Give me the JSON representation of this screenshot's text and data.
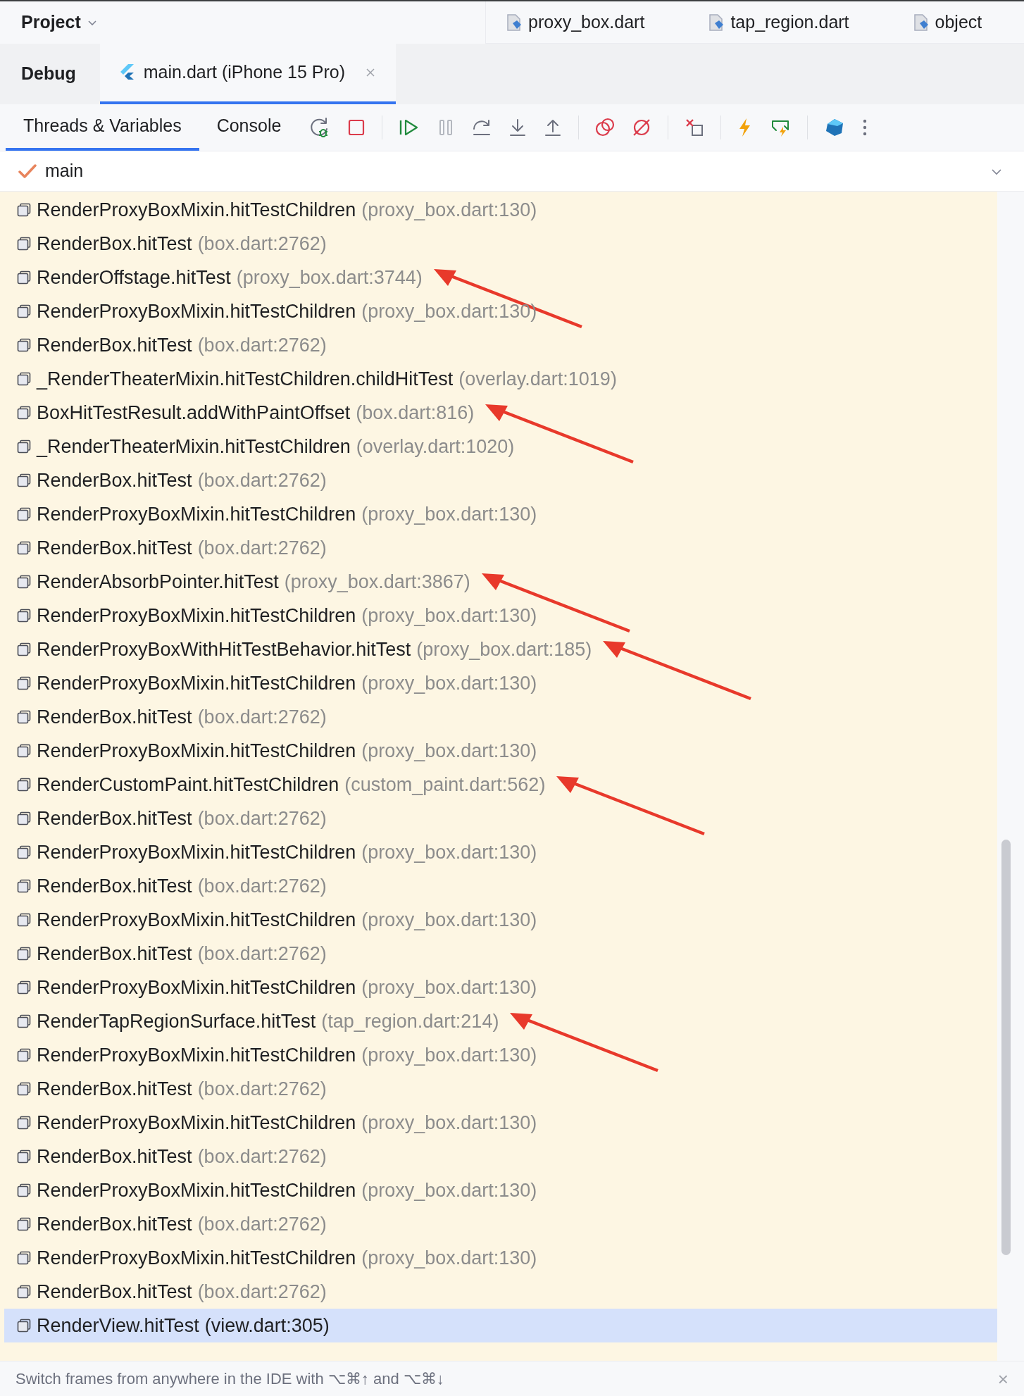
{
  "top_bar": {
    "panel_title": "Project",
    "editor_tabs": [
      {
        "label": "proxy_box.dart"
      },
      {
        "label": "tap_region.dart"
      },
      {
        "label": "object"
      }
    ]
  },
  "debug_bar": {
    "title": "Debug",
    "session_tab": {
      "label": "main.dart (iPhone 15 Pro)",
      "selected": true
    }
  },
  "toolbar": {
    "tabs": [
      {
        "label": "Threads & Variables",
        "selected": true
      },
      {
        "label": "Console",
        "selected": false
      }
    ]
  },
  "thread": {
    "name": "main"
  },
  "frames": [
    {
      "method": "RenderProxyBoxMixin.hitTestChildren",
      "location": "(proxy_box.dart:130)",
      "selected": false,
      "marked": false
    },
    {
      "method": "RenderBox.hitTest",
      "location": "(box.dart:2762)",
      "selected": false,
      "marked": false
    },
    {
      "method": "RenderOffstage.hitTest",
      "location": "(proxy_box.dart:3744)",
      "selected": false,
      "marked": true
    },
    {
      "method": "RenderProxyBoxMixin.hitTestChildren",
      "location": "(proxy_box.dart:130)",
      "selected": false,
      "marked": false
    },
    {
      "method": "RenderBox.hitTest",
      "location": "(box.dart:2762)",
      "selected": false,
      "marked": false
    },
    {
      "method": "_RenderTheaterMixin.hitTestChildren.childHitTest",
      "location": "(overlay.dart:1019)",
      "selected": false,
      "marked": false
    },
    {
      "method": "BoxHitTestResult.addWithPaintOffset",
      "location": "(box.dart:816)",
      "selected": false,
      "marked": true
    },
    {
      "method": "_RenderTheaterMixin.hitTestChildren",
      "location": "(overlay.dart:1020)",
      "selected": false,
      "marked": false
    },
    {
      "method": "RenderBox.hitTest",
      "location": "(box.dart:2762)",
      "selected": false,
      "marked": false
    },
    {
      "method": "RenderProxyBoxMixin.hitTestChildren",
      "location": "(proxy_box.dart:130)",
      "selected": false,
      "marked": false
    },
    {
      "method": "RenderBox.hitTest",
      "location": "(box.dart:2762)",
      "selected": false,
      "marked": false
    },
    {
      "method": "RenderAbsorbPointer.hitTest",
      "location": "(proxy_box.dart:3867)",
      "selected": false,
      "marked": true
    },
    {
      "method": "RenderProxyBoxMixin.hitTestChildren",
      "location": "(proxy_box.dart:130)",
      "selected": false,
      "marked": false
    },
    {
      "method": "RenderProxyBoxWithHitTestBehavior.hitTest",
      "location": "(proxy_box.dart:185)",
      "selected": false,
      "marked": true
    },
    {
      "method": "RenderProxyBoxMixin.hitTestChildren",
      "location": "(proxy_box.dart:130)",
      "selected": false,
      "marked": false
    },
    {
      "method": "RenderBox.hitTest",
      "location": "(box.dart:2762)",
      "selected": false,
      "marked": false
    },
    {
      "method": "RenderProxyBoxMixin.hitTestChildren",
      "location": "(proxy_box.dart:130)",
      "selected": false,
      "marked": false
    },
    {
      "method": "RenderCustomPaint.hitTestChildren",
      "location": "(custom_paint.dart:562)",
      "selected": false,
      "marked": true
    },
    {
      "method": "RenderBox.hitTest",
      "location": "(box.dart:2762)",
      "selected": false,
      "marked": false
    },
    {
      "method": "RenderProxyBoxMixin.hitTestChildren",
      "location": "(proxy_box.dart:130)",
      "selected": false,
      "marked": false
    },
    {
      "method": "RenderBox.hitTest",
      "location": "(box.dart:2762)",
      "selected": false,
      "marked": false
    },
    {
      "method": "RenderProxyBoxMixin.hitTestChildren",
      "location": "(proxy_box.dart:130)",
      "selected": false,
      "marked": false
    },
    {
      "method": "RenderBox.hitTest",
      "location": "(box.dart:2762)",
      "selected": false,
      "marked": false
    },
    {
      "method": "RenderProxyBoxMixin.hitTestChildren",
      "location": "(proxy_box.dart:130)",
      "selected": false,
      "marked": false
    },
    {
      "method": "RenderTapRegionSurface.hitTest",
      "location": "(tap_region.dart:214)",
      "selected": false,
      "marked": true
    },
    {
      "method": "RenderProxyBoxMixin.hitTestChildren",
      "location": "(proxy_box.dart:130)",
      "selected": false,
      "marked": false
    },
    {
      "method": "RenderBox.hitTest",
      "location": "(box.dart:2762)",
      "selected": false,
      "marked": false
    },
    {
      "method": "RenderProxyBoxMixin.hitTestChildren",
      "location": "(proxy_box.dart:130)",
      "selected": false,
      "marked": false
    },
    {
      "method": "RenderBox.hitTest",
      "location": "(box.dart:2762)",
      "selected": false,
      "marked": false
    },
    {
      "method": "RenderProxyBoxMixin.hitTestChildren",
      "location": "(proxy_box.dart:130)",
      "selected": false,
      "marked": false
    },
    {
      "method": "RenderBox.hitTest",
      "location": "(box.dart:2762)",
      "selected": false,
      "marked": false
    },
    {
      "method": "RenderProxyBoxMixin.hitTestChildren",
      "location": "(proxy_box.dart:130)",
      "selected": false,
      "marked": false
    },
    {
      "method": "RenderBox.hitTest",
      "location": "(box.dart:2762)",
      "selected": false,
      "marked": false
    },
    {
      "method": "RenderView.hitTest",
      "location": "(view.dart:305)",
      "selected": true,
      "marked": false
    }
  ],
  "hint_bar": {
    "text": "Switch frames from anywhere in the IDE with ⌥⌘↑ and ⌥⌘↓",
    "close": "×"
  }
}
